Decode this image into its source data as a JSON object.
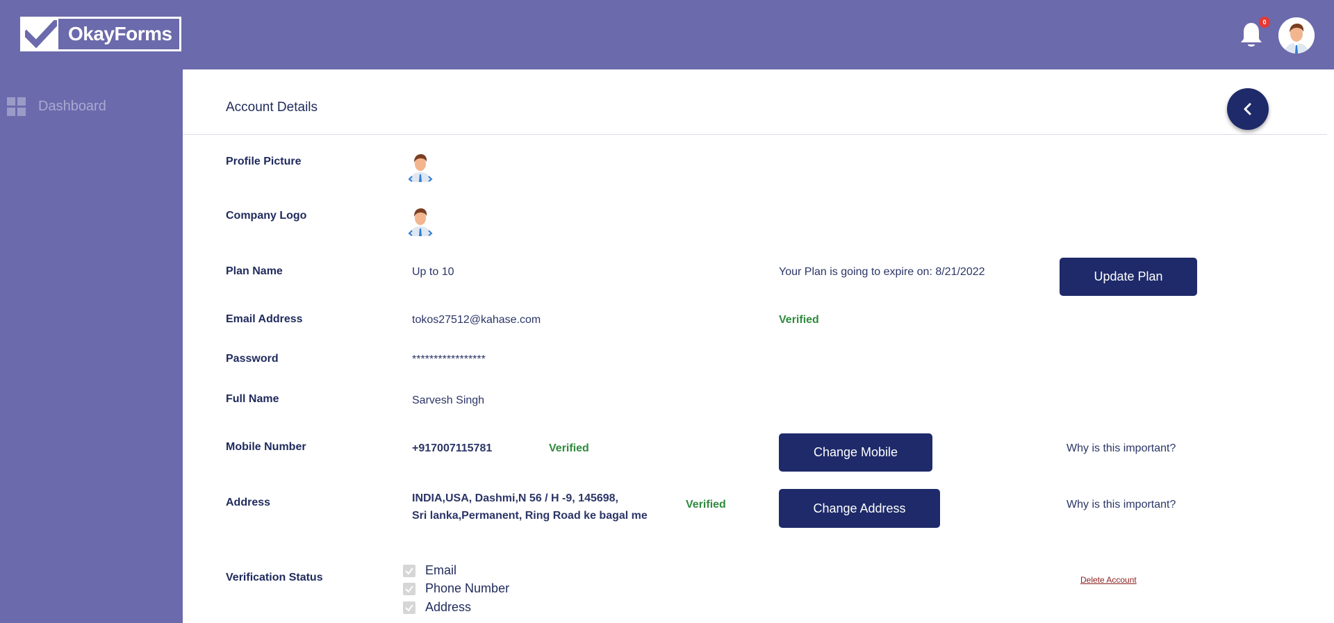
{
  "header": {
    "logo_text": "OkayForms",
    "notification_count": "0"
  },
  "sidebar": {
    "items": [
      {
        "label": "Dashboard",
        "icon": "dashboard-grid-icon"
      }
    ]
  },
  "main": {
    "title": "Account Details",
    "fields": {
      "profile_picture_label": "Profile Picture",
      "company_logo_label": "Company Logo",
      "plan_name_label": "Plan Name",
      "plan_name_value": "Up to 10",
      "plan_expiry_text": "Your Plan is going to expire on: 8/21/2022",
      "update_plan_button": "Update Plan",
      "email_label": "Email Address",
      "email_value": "tokos27512@kahase.com",
      "email_status": "Verified",
      "password_label": "Password",
      "password_value": "*****************",
      "full_name_label": "Full Name",
      "full_name_value": "Sarvesh Singh",
      "mobile_label": "Mobile Number",
      "mobile_value": "+917007115781",
      "mobile_status": "Verified",
      "change_mobile_button": "Change Mobile",
      "mobile_why": "Why is this important?",
      "address_label": "Address",
      "address_line1": "INDIA,USA, Dashmi,N 56 / H -9, 145698,",
      "address_line2": "Sri lanka,Permanent, Ring Road ke bagal me",
      "address_status": "Verified",
      "change_address_button": "Change Address",
      "address_why": "Why is this important?",
      "verification_label": "Verification Status",
      "verification_items": [
        "Email",
        "Phone Number",
        "Address"
      ],
      "delete_account": "Delete Account"
    }
  },
  "colors": {
    "brand": "#6b6aac",
    "button": "#1e2a69",
    "verified": "#2e8b3d",
    "delete": "#8b2020",
    "badge": "#e53935"
  }
}
